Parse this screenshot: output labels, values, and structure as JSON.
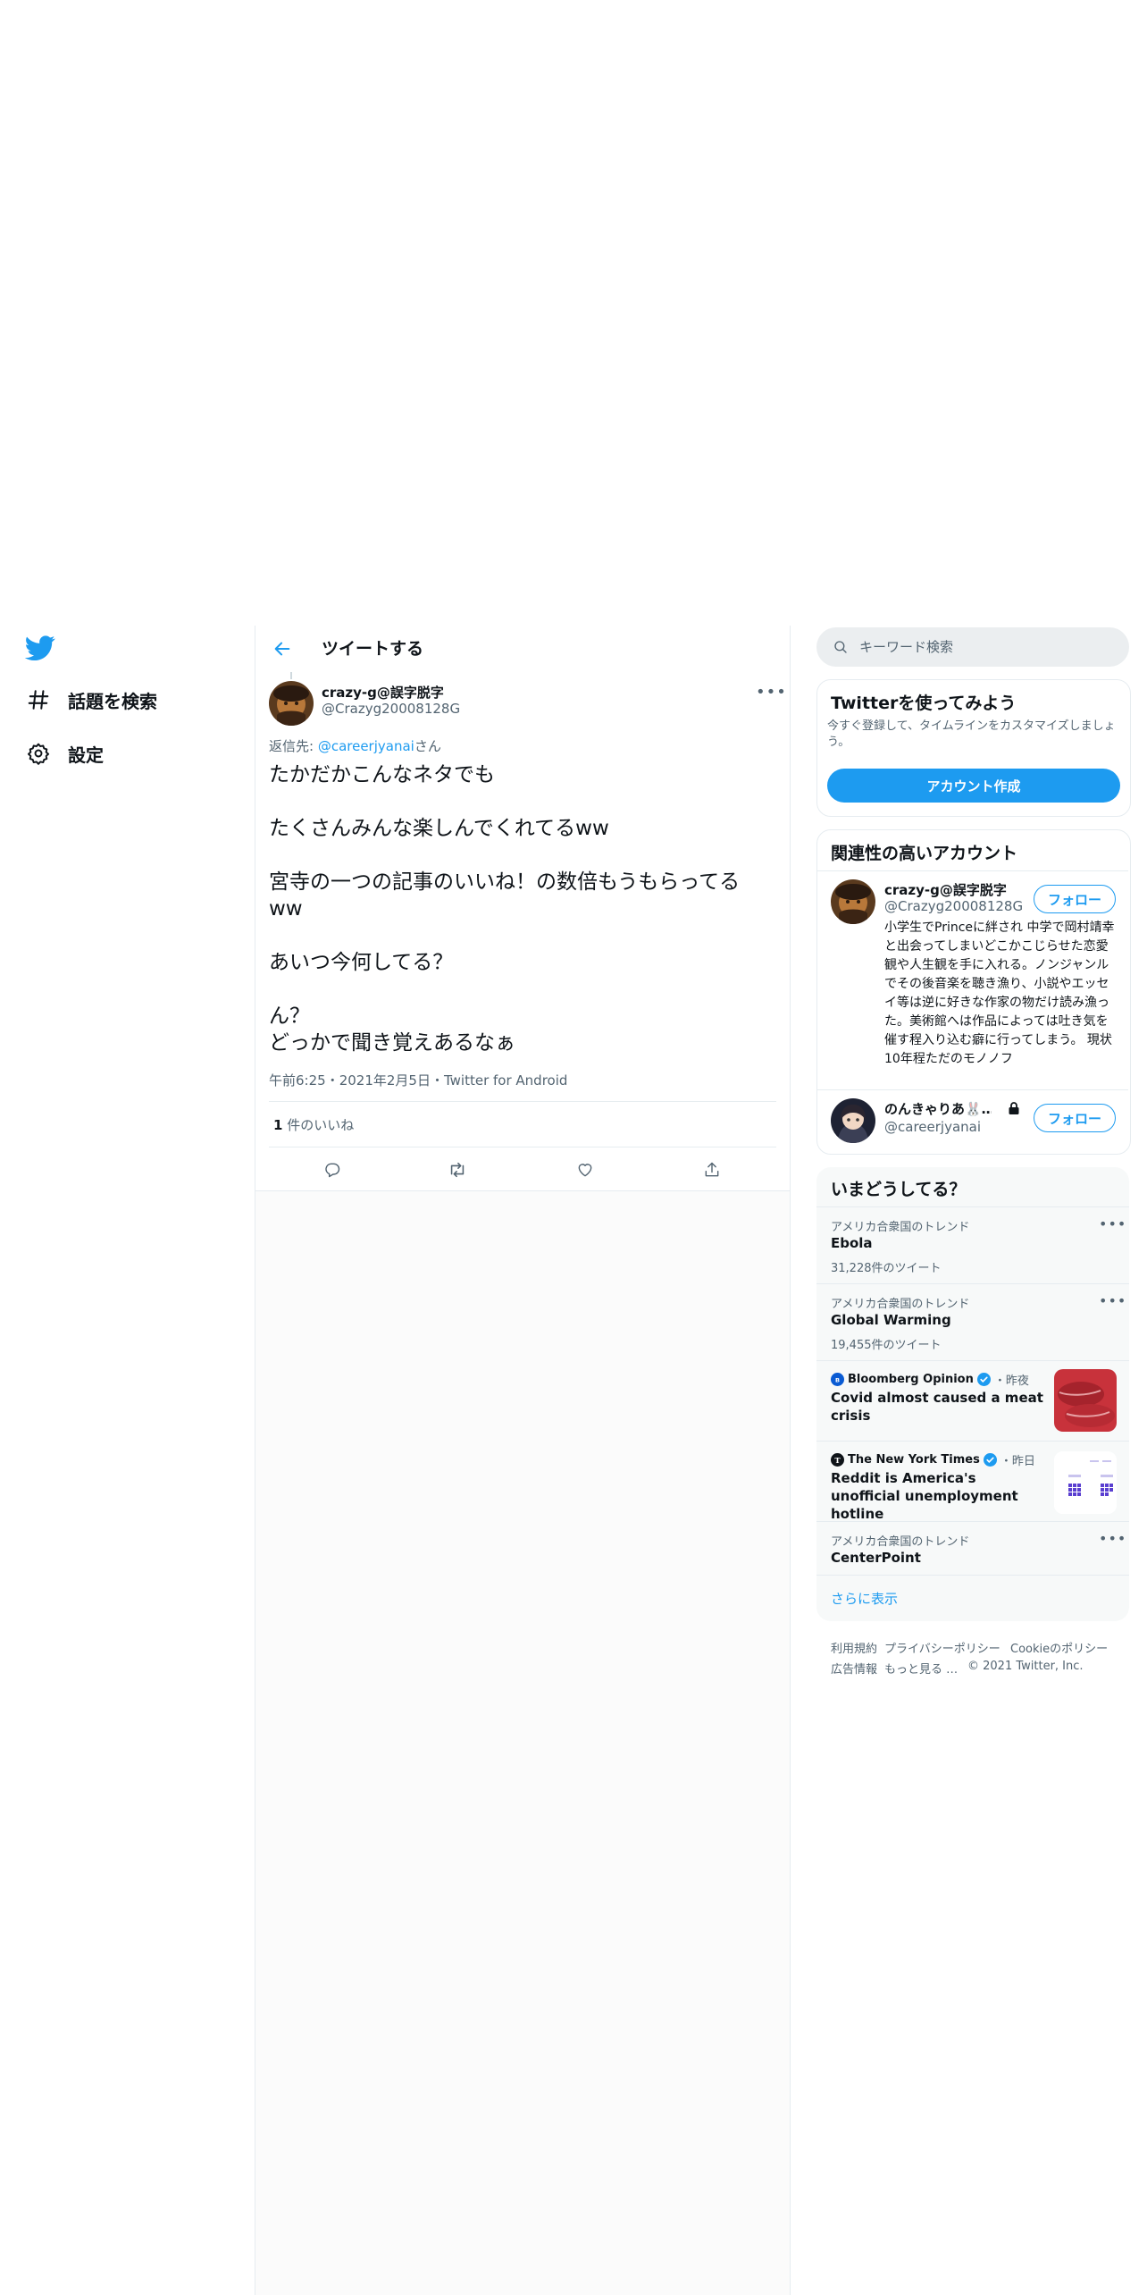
{
  "nav": {
    "items": [
      {
        "label": "話題を検索"
      },
      {
        "label": "設定"
      }
    ]
  },
  "header": {
    "title": "ツイートする"
  },
  "tweet": {
    "author_name": "crazy-g@誤字脱字",
    "author_handle": "@Crazyg20008128G",
    "reply_prefix": "返信先: ",
    "reply_mention": "@careerjyanai",
    "reply_suffix": "さん",
    "paragraphs": [
      "たかだかこんなネタでも",
      "たくさんみんな楽しんでくれてるww",
      "宮寺の一つの記事のいいね！の数倍もうもらってるww",
      "あいつ今何してる？",
      "ん？",
      "どっかで聞き覚えあるなぁ"
    ],
    "time": "午前6:25",
    "date": "2021年2月5日",
    "source": "Twitter for Android",
    "sep": "・",
    "like_count": "1",
    "like_label": " 件のいいね"
  },
  "search": {
    "placeholder": "キーワード検索"
  },
  "signup": {
    "title": "Twitterを使ってみよう",
    "desc": "今すぐ登録して、タイムラインをカスタマイズしましょう。",
    "button": "アカウント作成"
  },
  "related": {
    "title": "関連性の高いアカウント",
    "accounts": [
      {
        "name": "crazy-g@誤字脱字",
        "handle": "@Crazyg20008128G",
        "follow": "フォロー",
        "bio": "小学生でPrinceに絆され 中学で岡村靖幸と出会ってしまいどこかこじらせた恋愛観や人生観を手に入れる。ノンジャンルでその後音楽を聴き漁り、小説やエッセイ等は逆に好きな作家の物だけ読み漁った。美術館へは作品によっては吐き気を催す程入り込む癖に行ってしまう。 現状10年程ただのモノノフ"
      },
      {
        "name": "のんきゃりあ🐰…",
        "handle": "@careerjyanai",
        "follow": "フォロー"
      }
    ]
  },
  "trends": {
    "title": "いまどうしてる？",
    "items": [
      {
        "context": "アメリカ合衆国のトレンド",
        "name": "Ebola",
        "count": "31,228件のツイート"
      },
      {
        "context": "アメリカ合衆国のトレンド",
        "name": "Global Warming",
        "count": "19,455件のツイート"
      },
      {
        "source": "Bloomberg Opinion",
        "time": "・昨夜",
        "title": "Covid almost caused a meat crisis"
      },
      {
        "source": "The New York Times",
        "time": "・昨日",
        "title": "Reddit is America's unofficial unemployment hotline"
      },
      {
        "context": "アメリカ合衆国のトレンド",
        "name": "CenterPoint"
      }
    ],
    "show_more": "さらに表示"
  },
  "footer": {
    "links": [
      "利用規約",
      "プライバシーポリシー",
      "Cookieのポリシー",
      "広告情報",
      "もっと見る …"
    ],
    "copyright": "© 2021 Twitter, Inc."
  },
  "colors": {
    "accent": "#1d9bf0",
    "text": "#0f1419",
    "muted": "#536471"
  }
}
